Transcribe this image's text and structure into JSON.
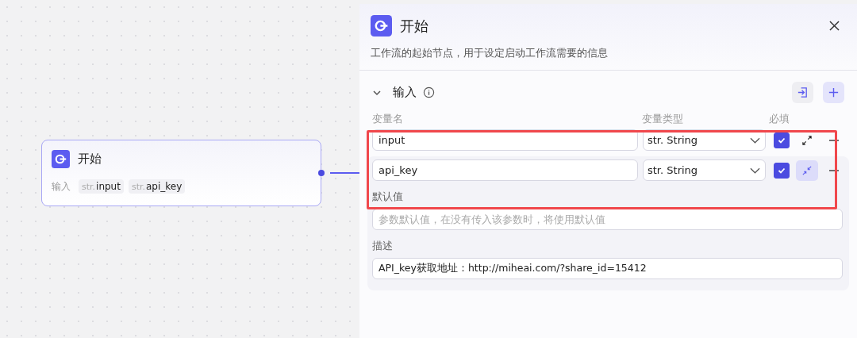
{
  "node": {
    "title": "开始",
    "inputs_label": "输入",
    "inputs": [
      {
        "type": "str.",
        "name": "input"
      },
      {
        "type": "str.",
        "name": "api_key"
      }
    ]
  },
  "panel": {
    "title": "开始",
    "description": "工作流的起始节点，用于设定启动工作流需要的信息",
    "section": {
      "title": "输入",
      "expanded": true
    },
    "columns": [
      "变量名",
      "变量类型",
      "必填"
    ],
    "variables": [
      {
        "name": "input",
        "type": "str. String",
        "required": true,
        "expanded": false
      },
      {
        "name": "api_key",
        "type": "str. String",
        "required": true,
        "expanded": true,
        "default_label": "默认值",
        "default_placeholder": "参数默认值，在没有传入该参数时，将使用默认值",
        "desc_label": "描述",
        "desc_value": "API_key获取地址：http://miheai.com/?share_id=15412"
      }
    ]
  }
}
